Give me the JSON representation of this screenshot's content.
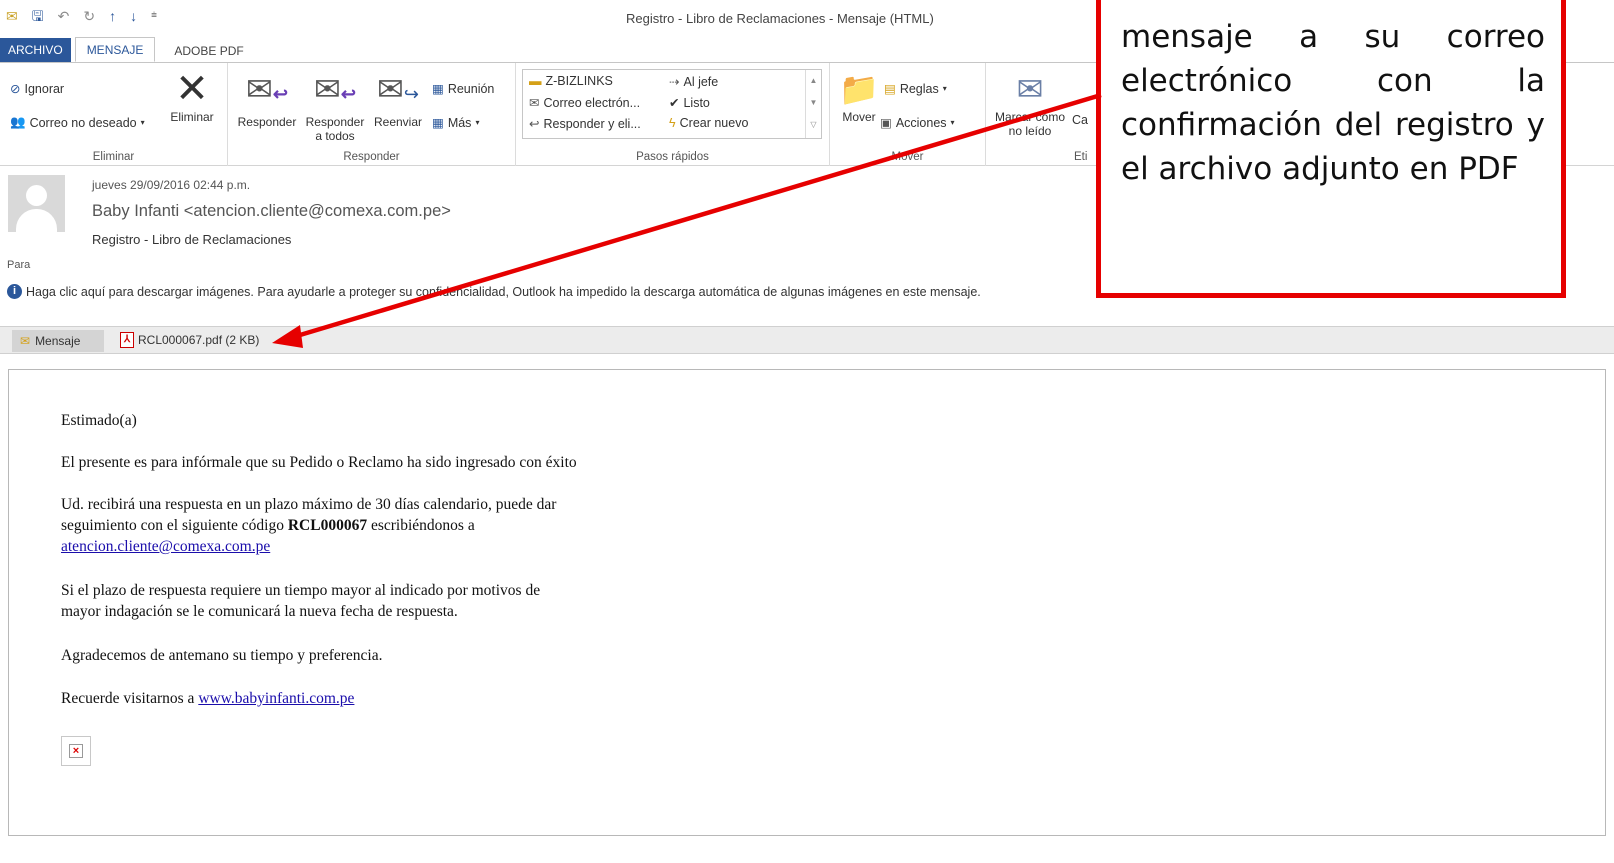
{
  "window": {
    "title": "Registro - Libro de Reclamaciones - Mensaje (HTML)"
  },
  "qat": {
    "items": [
      "mail-icon",
      "save-icon",
      "undo-icon",
      "redo-icon",
      "up-icon",
      "down-icon",
      "customize-icon"
    ]
  },
  "tabs": {
    "file": "ARCHIVO",
    "message": "MENSAJE",
    "adobe": "ADOBE PDF"
  },
  "ribbon": {
    "delete_group": {
      "ignore": "Ignorar",
      "junk": "Correo no deseado",
      "delete": "Eliminar",
      "label": "Eliminar"
    },
    "respond_group": {
      "reply": "Responder",
      "reply_all_1": "Responder",
      "reply_all_2": "a todos",
      "forward": "Reenviar",
      "meeting": "Reunión",
      "more": "Más",
      "label": "Responder"
    },
    "quick_steps": {
      "items": [
        "Z-BIZLINKS",
        "Al jefe",
        "Correo electrón...",
        "Listo",
        "Responder y eli...",
        "Crear nuevo"
      ],
      "label": "Pasos rápidos"
    },
    "move_group": {
      "move": "Mover",
      "rules": "Reglas",
      "actions": "Acciones",
      "label": "Mover"
    },
    "tags_group": {
      "mark_unread_1": "Marcar como",
      "mark_unread_2": "no leído",
      "cat": "Ca",
      "label": "Eti"
    }
  },
  "header": {
    "date": "jueves 29/09/2016 02:44 p.m.",
    "from": "Baby Infanti <atencion.cliente@comexa.com.pe>",
    "subject": "Registro - Libro de Reclamaciones",
    "to_label": "Para",
    "info_bar": "Haga clic aquí para descargar imágenes. Para ayudarle a proteger su confidencialidad, Outlook ha impedido la descarga automática de algunas imágenes en este mensaje."
  },
  "attachments": {
    "message_tab": "Mensaje",
    "file": "RCL000067.pdf (2 KB)"
  },
  "body": {
    "greeting": "Estimado(a)",
    "line1": "El presente es para infórmale que su Pedido o Reclamo ha sido ingresado con éxito",
    "p2_l1": "Ud. recibirá una respuesta en un plazo máximo de 30 días calendario, puede dar",
    "p2_l2_pre": "seguimiento con el siguiente código ",
    "p2_code": "RCL000067",
    "p2_l2_post": " escribiéndonos a",
    "p2_email": "atencion.cliente@comexa.com.pe",
    "p3_l1": "Si el plazo de respuesta requiere un tiempo mayor al indicado por motivos de",
    "p3_l2": "mayor indagación se le comunicará la nueva fecha de respuesta.",
    "p4": "Agradecemos de antemano su tiempo y preferencia.",
    "p5_pre": "Recuerde visitarnos a ",
    "p5_link": "www.babyinfanti.com.pe"
  },
  "callout": {
    "text": "mensaje a su correo electrónico con la confirmación del registro y el archivo adjunto en PDF",
    "color": "#e60000"
  }
}
